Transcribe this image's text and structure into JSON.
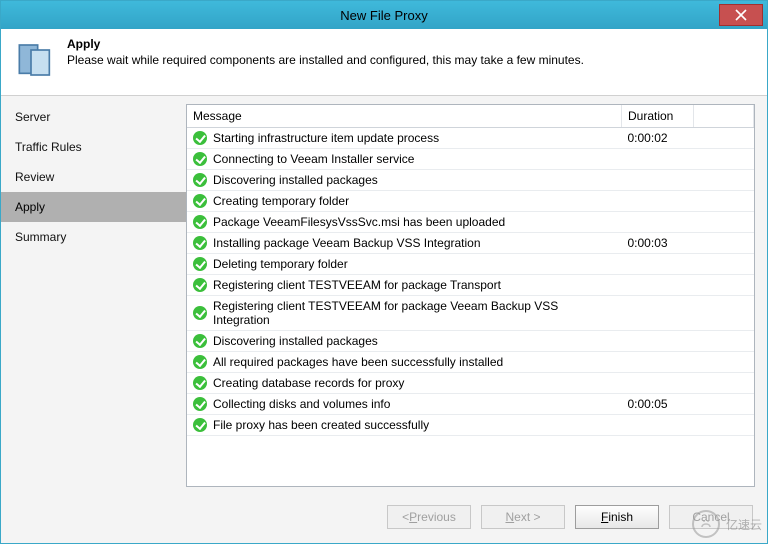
{
  "window": {
    "title": "New File Proxy"
  },
  "header": {
    "title": "Apply",
    "subtitle": "Please wait while required components are installed and configured, this may take a few minutes."
  },
  "sidebar": {
    "items": [
      {
        "label": "Server",
        "selected": false
      },
      {
        "label": "Traffic Rules",
        "selected": false
      },
      {
        "label": "Review",
        "selected": false
      },
      {
        "label": "Apply",
        "selected": true
      },
      {
        "label": "Summary",
        "selected": false
      }
    ]
  },
  "grid": {
    "columns": {
      "message": "Message",
      "duration": "Duration"
    },
    "rows": [
      {
        "message": "Starting infrastructure item update process",
        "duration": "0:00:02"
      },
      {
        "message": "Connecting to Veeam Installer service",
        "duration": ""
      },
      {
        "message": "Discovering installed packages",
        "duration": ""
      },
      {
        "message": "Creating temporary folder",
        "duration": ""
      },
      {
        "message": "Package VeeamFilesysVssSvc.msi has been uploaded",
        "duration": ""
      },
      {
        "message": "Installing package Veeam Backup VSS Integration",
        "duration": "0:00:03"
      },
      {
        "message": "Deleting temporary folder",
        "duration": ""
      },
      {
        "message": "Registering client TESTVEEAM for package Transport",
        "duration": ""
      },
      {
        "message": "Registering client TESTVEEAM for package Veeam Backup VSS Integration",
        "duration": ""
      },
      {
        "message": "Discovering installed packages",
        "duration": ""
      },
      {
        "message": "All required packages have been successfully installed",
        "duration": ""
      },
      {
        "message": "Creating database records for proxy",
        "duration": ""
      },
      {
        "message": "Collecting disks and volumes info",
        "duration": "0:00:05"
      },
      {
        "message": "File proxy has been created successfully",
        "duration": ""
      }
    ]
  },
  "buttons": {
    "previous": {
      "prefix": "< ",
      "ul": "P",
      "rest": "revious"
    },
    "next": {
      "ul": "N",
      "rest": "ext >"
    },
    "finish": {
      "ul": "F",
      "rest": "inish"
    },
    "cancel": {
      "label": "Cancel"
    }
  },
  "watermark": "亿速云"
}
